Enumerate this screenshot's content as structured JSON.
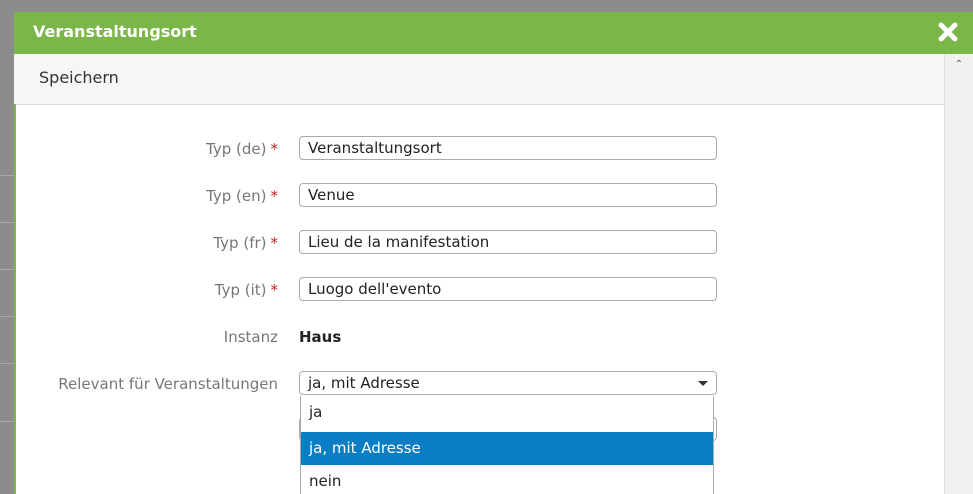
{
  "dialog": {
    "title": "Veranstaltungsort",
    "close_icon": "close-x-icon",
    "toolbar": {
      "save_label": "Speichern"
    }
  },
  "form": {
    "required_marker": "*",
    "type_de": {
      "label": "Typ (de)",
      "value": "Veranstaltungsort"
    },
    "type_en": {
      "label": "Typ (en)",
      "value": "Venue"
    },
    "type_fr": {
      "label": "Typ (fr)",
      "value": "Lieu de la manifestation"
    },
    "type_it": {
      "label": "Typ (it)",
      "value": "Luogo dell'evento"
    },
    "instance": {
      "label": "Instanz",
      "value": "Haus"
    },
    "relevant": {
      "label": "Relevant für Veranstaltungen",
      "value": "ja, mit Adresse",
      "options": [
        "ja",
        "ja, mit Adresse",
        "nein"
      ]
    }
  },
  "colors": {
    "titlebar": "#7ab648",
    "selected_option": "#0a7ec4",
    "required": "#cc2222"
  }
}
